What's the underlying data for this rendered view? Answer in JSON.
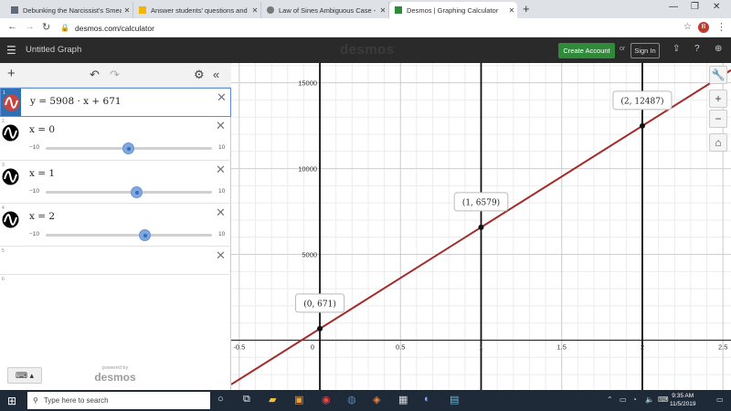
{
  "browser": {
    "tabs": [
      {
        "title": "Debunking the Narcissist's Smea",
        "favicon_color": "#5f6b7a"
      },
      {
        "title": "Answer students' questions and",
        "favicon_color": "#f4b400"
      },
      {
        "title": "Law of Sines Ambiguous Case - Y",
        "favicon_color": "#777777"
      },
      {
        "title": "Desmos | Graphing Calculator",
        "favicon_color": "#2f8a3a",
        "active": true
      }
    ],
    "url": "desmos.com/calculator",
    "profile_initial": "B"
  },
  "desmos": {
    "graph_title": "Untitled Graph",
    "logo": "desmos",
    "create_account": "Create Account",
    "or": "or",
    "sign_in": "Sign In",
    "powered_by": "powered by",
    "powered_logo": "desmos",
    "expressions": [
      {
        "num": "1",
        "text": "y = 5908 · x + 671",
        "color": "#c74440"
      },
      {
        "num": "2",
        "text": "x = 0",
        "slider": {
          "min": "−10",
          "max": "10",
          "value": 0
        }
      },
      {
        "num": "3",
        "text": "x = 1",
        "slider": {
          "min": "−10",
          "max": "10",
          "value": 1
        }
      },
      {
        "num": "4",
        "text": "x = 2",
        "slider": {
          "min": "−10",
          "max": "10",
          "value": 2
        }
      },
      {
        "num": "5",
        "text": ""
      },
      {
        "num": "6",
        "text": ""
      }
    ]
  },
  "chart_data": {
    "type": "line",
    "equation": "y = 5908 · x + 671",
    "slope": 5908,
    "intercept": 671,
    "xlim": [
      -0.55,
      2.55
    ],
    "ylim": [
      -2900,
      16150
    ],
    "x_ticks": [
      "-0.5",
      "0",
      "0.5",
      "1",
      "1.5",
      "2",
      "2.5"
    ],
    "y_ticks": [
      "5000",
      "10000",
      "15000"
    ],
    "line_color": "#a52a2a",
    "vertical_lines": [
      0,
      1,
      2
    ],
    "points": [
      {
        "x": 0,
        "y": 671,
        "label": "(0, 671)"
      },
      {
        "x": 1,
        "y": 6579,
        "label": "(1, 6579)"
      },
      {
        "x": 2,
        "y": 12487,
        "label": "(2, 12487)"
      }
    ]
  },
  "taskbar": {
    "search_placeholder": "Type here to search",
    "time": "9:35 AM",
    "date": "11/5/2019"
  }
}
